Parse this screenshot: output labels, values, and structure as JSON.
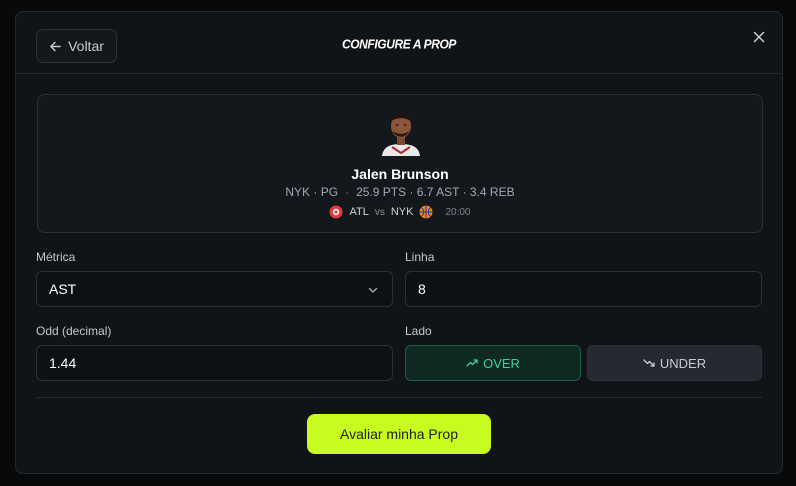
{
  "header": {
    "back_label": "Voltar",
    "title": "CONFIGURE A PROP"
  },
  "player": {
    "name": "Jalen Brunson",
    "team_position": "NYK · PG",
    "stats": "25.9 PTS · 6.7 AST · 3.4 REB",
    "away_team": "ATL",
    "vs": "vs",
    "home_team": "NYK",
    "time": "20:00"
  },
  "form": {
    "metric_label": "Métrica",
    "metric_value": "AST",
    "line_label": "Linha",
    "line_value": "8",
    "odd_label": "Odd (decimal)",
    "odd_value": "1.44",
    "side_label": "Lado",
    "over_label": "OVER",
    "under_label": "UNDER"
  },
  "submit_label": "Avaliar minha Prop",
  "colors": {
    "accent": "#c8fb1f",
    "over_green": "#3fd19a",
    "background": "#111417"
  },
  "icons": {
    "back": "arrow-left-icon",
    "close": "close-icon",
    "chevron": "chevron-down-icon",
    "over": "trending-up-icon",
    "under": "trending-down-icon"
  }
}
